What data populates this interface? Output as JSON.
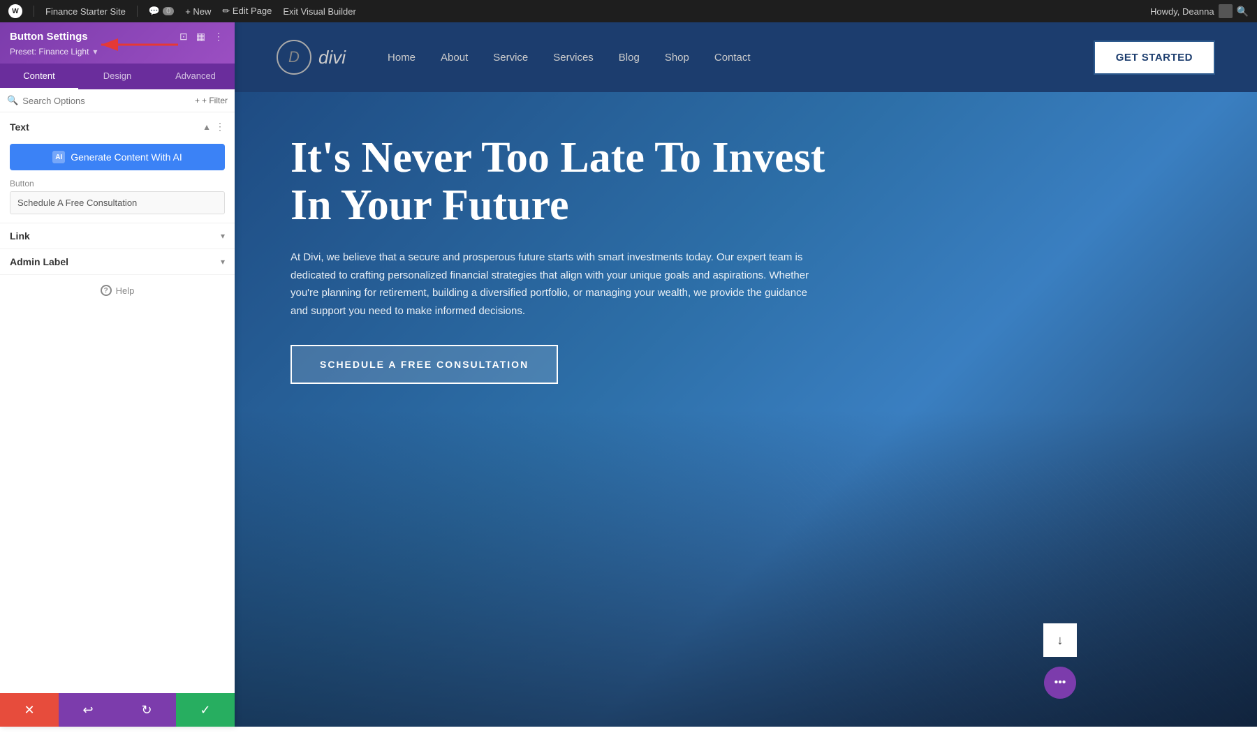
{
  "adminBar": {
    "wpLabel": "W",
    "siteName": "Finance Starter Site",
    "commentsIcon": "💬",
    "commentsCount": "0",
    "newLabel": "+ New",
    "editPageLabel": "✏ Edit Page",
    "exitBuilderLabel": "Exit Visual Builder",
    "howdyLabel": "Howdy, Deanna",
    "searchIcon": "🔍"
  },
  "panel": {
    "title": "Button Settings",
    "presetLabel": "Preset: Finance Light",
    "tabs": [
      "Content",
      "Design",
      "Advanced"
    ],
    "activeTab": "Content",
    "searchPlaceholder": "Search Options",
    "filterLabel": "+ Filter",
    "sections": {
      "text": {
        "title": "Text",
        "aiButton": "Generate Content With AI",
        "buttonLabel": "Button",
        "buttonValue": "Schedule A Free Consultation"
      },
      "link": {
        "title": "Link"
      },
      "adminLabel": {
        "title": "Admin Label"
      }
    },
    "helpLabel": "Help",
    "bottomBtns": {
      "cancel": "✕",
      "undo": "↩",
      "redo": "↻",
      "save": "✓"
    }
  },
  "site": {
    "logo": "D",
    "logoText": "divi",
    "nav": {
      "items": [
        "Home",
        "About",
        "Service",
        "Services",
        "Blog",
        "Shop",
        "Contact"
      ]
    },
    "ctaButton": "GET STARTED",
    "hero": {
      "title": "It's Never Too Late To Invest In Your Future",
      "description": "At Divi, we believe that a secure and prosperous future starts with smart investments today. Our expert team is dedicated to crafting personalized financial strategies that align with your unique goals and aspirations. Whether you're planning for retirement, building a diversified portfolio, or managing your wealth, we provide the guidance and support you need to make informed decisions.",
      "ctaButton": "SCHEDULE A FREE CONSULTATION"
    }
  }
}
